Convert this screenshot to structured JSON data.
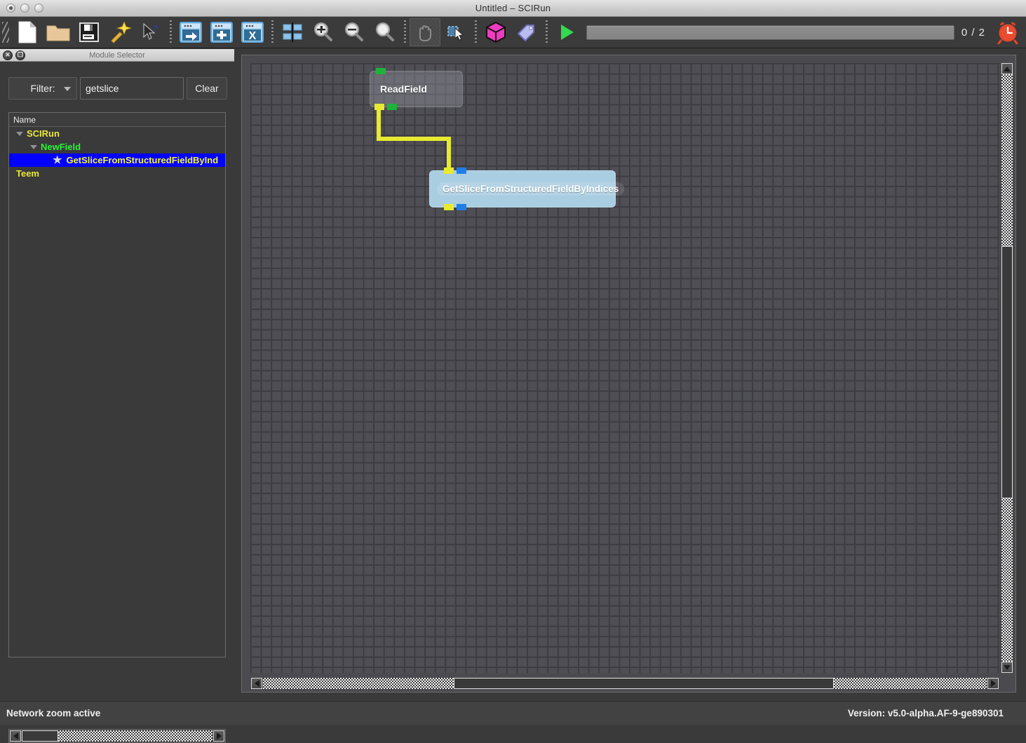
{
  "window": {
    "title": "Untitled – SCIRun",
    "controls": [
      "close",
      "minimize",
      "zoom"
    ]
  },
  "toolbar": {
    "items": [
      {
        "name": "new-file-button",
        "icon": "document-icon"
      },
      {
        "name": "open-file-button",
        "icon": "folder-icon"
      },
      {
        "name": "save-file-button",
        "icon": "floppy-disk-icon"
      },
      {
        "name": "wizard-button",
        "icon": "magic-wand-icon"
      },
      {
        "name": "whats-this-button",
        "icon": "cursor-question-icon"
      },
      {
        "name": "execute-all-button",
        "icon": "window-arrow-icon"
      },
      {
        "name": "insert-module-button",
        "icon": "window-plus-icon"
      },
      {
        "name": "clear-network-button",
        "icon": "window-x-icon"
      },
      {
        "name": "align-modules-button",
        "icon": "align-icon"
      },
      {
        "name": "zoom-in-button",
        "icon": "magnifier-plus-icon"
      },
      {
        "name": "zoom-out-button",
        "icon": "magnifier-minus-icon"
      },
      {
        "name": "zoom-reset-button",
        "icon": "magnifier-icon"
      },
      {
        "name": "pan-tool-button",
        "icon": "hand-icon"
      },
      {
        "name": "select-tool-button",
        "icon": "marquee-cursor-icon"
      },
      {
        "name": "module-box-button",
        "icon": "pink-cube-icon"
      },
      {
        "name": "tag-button",
        "icon": "tag-icon"
      },
      {
        "name": "run-button",
        "icon": "play-triangle-icon"
      }
    ],
    "counter": "0 / 2",
    "alarm_icon": "alarm-clock-icon",
    "progress_value": 0
  },
  "module_selector": {
    "title": "Module Selector",
    "close_label": "✕",
    "float_label": "❐",
    "filter_label": "Filter:",
    "filter_value": "getslice",
    "filter_placeholder": "",
    "clear_label": "Clear",
    "tree_header": "Name",
    "tree": [
      {
        "label": "SCIRun",
        "level": 0,
        "twisty": true,
        "star": false,
        "selected": false
      },
      {
        "label": "NewField",
        "level": 1,
        "twisty": true,
        "star": false,
        "selected": false
      },
      {
        "label": "GetSliceFromStructuredFieldByInd",
        "level": 2,
        "twisty": false,
        "star": true,
        "selected": true
      },
      {
        "label": "Teem",
        "level": 0,
        "twisty": false,
        "star": false,
        "selected": false
      }
    ]
  },
  "network": {
    "modules": [
      {
        "name": "ReadField",
        "inputs": [
          {
            "color": "green"
          }
        ],
        "outputs": [
          {
            "color": "yellow"
          },
          {
            "color": "green"
          }
        ]
      },
      {
        "name": "GetSliceFromStructuredFieldByIndices",
        "inputs": [
          {
            "color": "yellow"
          },
          {
            "color": "blue"
          }
        ],
        "outputs": [
          {
            "color": "yellow"
          },
          {
            "color": "blue"
          }
        ]
      }
    ],
    "connection_color": "#e8ea30"
  },
  "status": {
    "left": "Network zoom active",
    "right": "Version: v5.0-alpha.AF-9-ge890301"
  },
  "colors": {
    "selection_blue": "#0000ff",
    "tree_category": "#e8e83c",
    "tree_subcategory": "#2cf03a",
    "tree_selected_text": "#f5f53a",
    "module_blue": "#a9cde1",
    "port_green": "#1eb23c",
    "port_yellow": "#e8ea30",
    "port_blue": "#1f7ee8",
    "run_green": "#33d94f",
    "alarm_red": "#e8462a"
  }
}
